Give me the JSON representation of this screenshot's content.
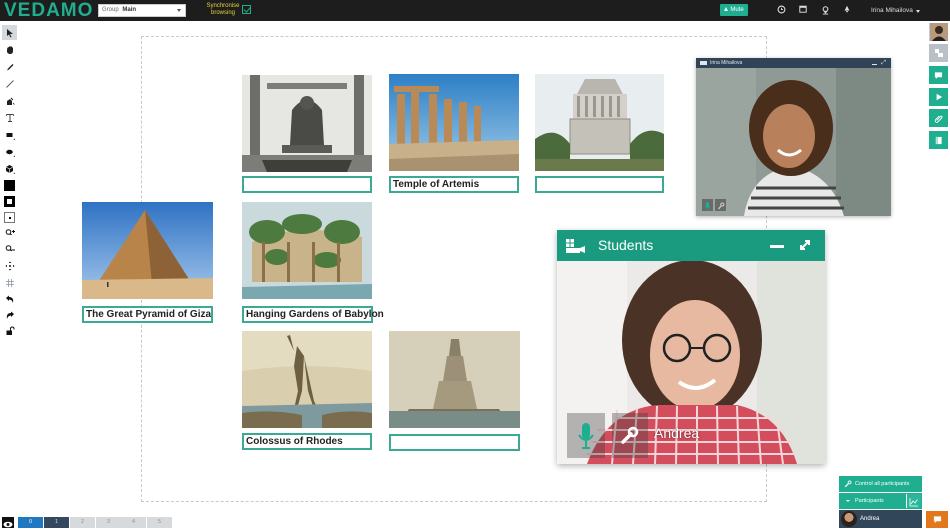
{
  "app": {
    "logo": "VEDAMO",
    "group_label": "Group",
    "group_value": "Main",
    "sync_label_line1": "Synchronise",
    "sync_label_line2": "browsing",
    "sync_checked": true,
    "mute_label": "Mute",
    "user_name": "Irina Mihailova"
  },
  "colors": {
    "accent": "#1fae8f",
    "topbar": "#1d1d1d",
    "panel_dark": "#324659",
    "chat": "#e3771b",
    "sync_text": "#e8d23b"
  },
  "top_icons": [
    "clock-icon",
    "calendar-icon",
    "map-pin-icon",
    "bell-icon"
  ],
  "left_tools": [
    {
      "name": "select-tool",
      "active": true
    },
    {
      "name": "pan-tool"
    },
    {
      "name": "pen-tool"
    },
    {
      "name": "line-tool"
    },
    {
      "name": "fill-tool"
    },
    {
      "name": "text-tool"
    },
    {
      "name": "rectangle-tool"
    },
    {
      "name": "ellipse-tool"
    },
    {
      "name": "shapes-tool"
    },
    {
      "name": "fill-color-swatch"
    },
    {
      "name": "stroke-color-swatch"
    },
    {
      "name": "stroke-width-swatch"
    },
    {
      "name": "zoom-in-tool"
    },
    {
      "name": "zoom-out-tool"
    },
    {
      "name": "move-tool"
    },
    {
      "name": "grid-tool"
    },
    {
      "name": "undo-tool"
    },
    {
      "name": "redo-tool"
    },
    {
      "name": "lock-tool"
    }
  ],
  "board": {
    "cards": [
      {
        "id": "zeus",
        "caption": ""
      },
      {
        "id": "artemis",
        "caption": "Temple of Artemis"
      },
      {
        "id": "mausoleum",
        "caption": ""
      },
      {
        "id": "pyramid",
        "caption": "The Great Pyramid of Giza"
      },
      {
        "id": "gardens",
        "caption": "Hanging Gardens of Babylon"
      },
      {
        "id": "colossus",
        "caption": "Colossus of Rhodes"
      },
      {
        "id": "lighthouse",
        "caption": ""
      }
    ]
  },
  "teacher_video": {
    "name": "Irina Mihailova"
  },
  "students_video": {
    "title": "Students",
    "student_name": "Andrea"
  },
  "right_toolbar": [
    "user-avatar",
    "layout-icon",
    "chat-icon",
    "play-icon",
    "attachment-icon",
    "notebook-icon"
  ],
  "participants_panel": {
    "control_all_label": "Control all participants",
    "participants_label": "Participants",
    "participants": [
      {
        "name": "Andrea"
      }
    ]
  },
  "pages": {
    "tabs": [
      "0",
      "1",
      "2",
      "3",
      "4",
      "5"
    ],
    "current": "1"
  }
}
